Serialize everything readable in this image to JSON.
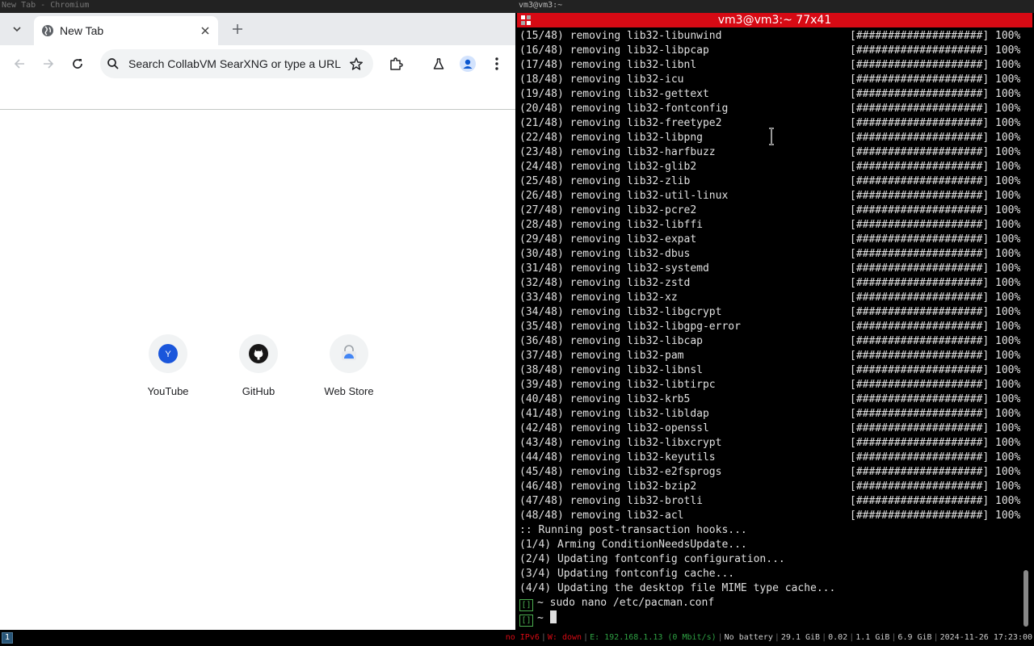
{
  "left_window_title": "New Tab - Chromium",
  "right_window_title": "vm3@vm3:~",
  "browser": {
    "tab_title": "New Tab",
    "omnibox_placeholder": "Search CollabVM SearXNG or type a URL",
    "shortcuts": [
      {
        "label": "YouTube",
        "icon": "youtube-letter-icon",
        "letter": "Y"
      },
      {
        "label": "GitHub",
        "icon": "github-icon"
      },
      {
        "label": "Web Store",
        "icon": "webstore-icon"
      }
    ],
    "accent_color": "#1a73e8"
  },
  "terminal": {
    "title": "vm3@vm3:~ 77x41",
    "bar_color": "#d70a14",
    "progress_bar": "[####################]",
    "progress_percent": "100%",
    "removal_lines": [
      "(15/48) removing lib32-libunwind",
      "(16/48) removing lib32-libpcap",
      "(17/48) removing lib32-libnl",
      "(18/48) removing lib32-icu",
      "(19/48) removing lib32-gettext",
      "(20/48) removing lib32-fontconfig",
      "(21/48) removing lib32-freetype2",
      "(22/48) removing lib32-libpng",
      "(23/48) removing lib32-harfbuzz",
      "(24/48) removing lib32-glib2",
      "(25/48) removing lib32-zlib",
      "(26/48) removing lib32-util-linux",
      "(27/48) removing lib32-pcre2",
      "(28/48) removing lib32-libffi",
      "(29/48) removing lib32-expat",
      "(30/48) removing lib32-dbus",
      "(31/48) removing lib32-systemd",
      "(32/48) removing lib32-zstd",
      "(33/48) removing lib32-xz",
      "(34/48) removing lib32-libgcrypt",
      "(35/48) removing lib32-libgpg-error",
      "(36/48) removing lib32-libcap",
      "(37/48) removing lib32-pam",
      "(38/48) removing lib32-libnsl",
      "(39/48) removing lib32-libtirpc",
      "(40/48) removing lib32-krb5",
      "(41/48) removing lib32-libldap",
      "(42/48) removing lib32-openssl",
      "(43/48) removing lib32-libxcrypt",
      "(44/48) removing lib32-keyutils",
      "(45/48) removing lib32-e2fsprogs",
      "(46/48) removing lib32-bzip2",
      "(47/48) removing lib32-brotli",
      "(48/48) removing lib32-acl"
    ],
    "hook_lines": [
      ":: Running post-transaction hooks...",
      "(1/4) Arming ConditionNeedsUpdate...",
      "(2/4) Updating fontconfig configuration...",
      "(3/4) Updating fontconfig cache...",
      "(4/4) Updating the desktop file MIME type cache..."
    ],
    "prompt_symbol": "~",
    "last_command": "sudo nano /etc/pacman.conf"
  },
  "statusbar": {
    "workspace": "1",
    "items": [
      {
        "text": "no IPv6",
        "color": "#d70a14"
      },
      {
        "text": "W: down",
        "color": "#d70a14"
      },
      {
        "text": "E: 192.168.1.13 (0 Mbit/s)",
        "color": "#2ea043"
      },
      {
        "text": "No battery",
        "color": "#cccccc"
      },
      {
        "text": "29.1 GiB",
        "color": "#cccccc"
      },
      {
        "text": "0.02",
        "color": "#cccccc"
      },
      {
        "text": "1.1 GiB",
        "color": "#cccccc"
      },
      {
        "text": "6.9 GiB",
        "color": "#cccccc"
      },
      {
        "text": "2024-11-26 17:23:00",
        "color": "#cccccc"
      }
    ]
  }
}
